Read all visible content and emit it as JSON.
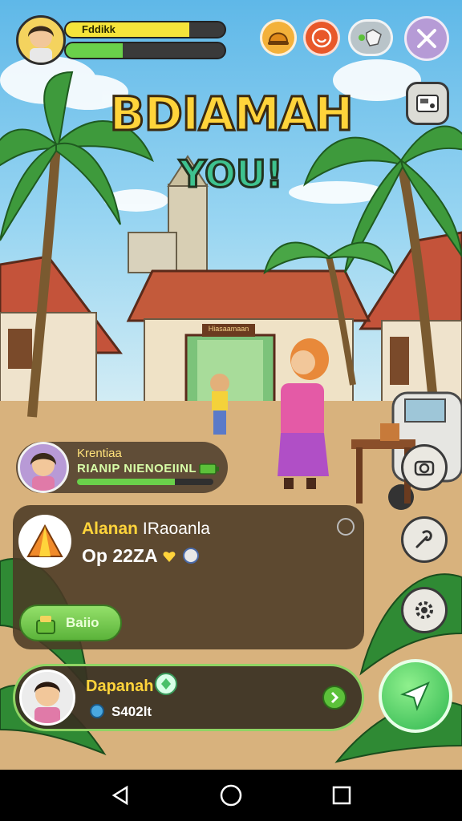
{
  "hud": {
    "player_name": "Fddikk",
    "health_fill": 0.78,
    "xp_fill": 0.36,
    "health_color": "#f5e43a",
    "xp_color": "#6ad04a",
    "buttons": [
      "helmet-icon",
      "smile-icon",
      "map-icon",
      "tools-icon"
    ],
    "side_button_top": "photo-icon"
  },
  "title": {
    "line1": "BDIAMAH",
    "line2": "YOU!"
  },
  "scene": {
    "gate_sign": "Hiasaamaan"
  },
  "npc": {
    "name": "Krentiaa",
    "dialogue": "RIANIP NIENOEIINL",
    "progress": 0.72
  },
  "quest": {
    "title": "Alanan",
    "subtitle": "IRaoanla",
    "value": "Op 22ZA",
    "button_label": "Baiio",
    "icon": "tent-icon"
  },
  "player": {
    "name": "Dapanah",
    "coins": "S402lt"
  },
  "side_buttons": [
    "camera-icon",
    "wrench-icon",
    "gear-icon"
  ],
  "action_button": "send-icon",
  "nav": [
    "back-icon",
    "home-icon",
    "recents-icon"
  ]
}
